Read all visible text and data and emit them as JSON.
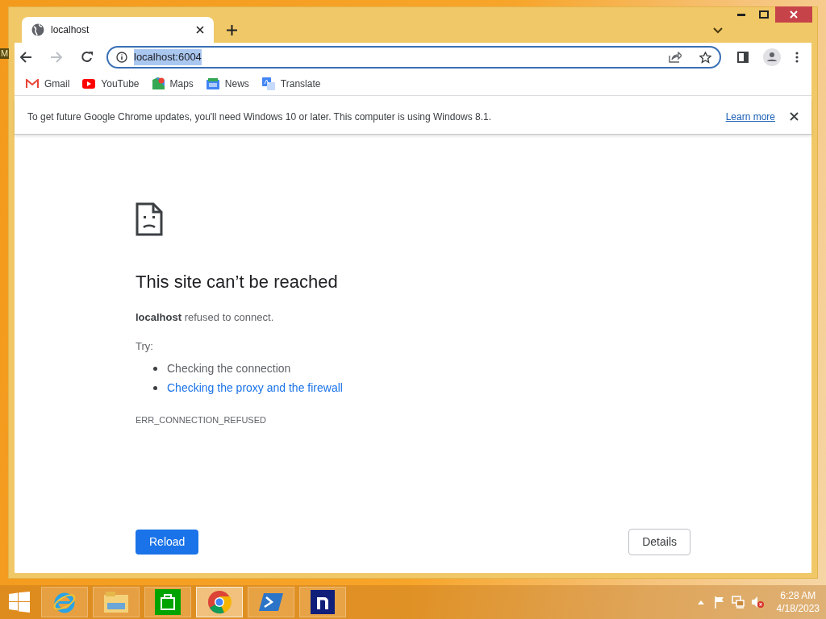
{
  "desktop_label": "M",
  "tab": {
    "title": "localhost",
    "selected": true
  },
  "address": {
    "value": "localhost:6004",
    "selected": true
  },
  "bookmarks": [
    {
      "kind": "gmail",
      "label": "Gmail"
    },
    {
      "kind": "youtube",
      "label": "YouTube"
    },
    {
      "kind": "maps",
      "label": "Maps"
    },
    {
      "kind": "news",
      "label": "News"
    },
    {
      "kind": "translate",
      "label": "Translate"
    }
  ],
  "infobar": {
    "message": "To get future Google Chrome updates, you'll need Windows 10 or later. This computer is using Windows 8.1.",
    "link": "Learn more"
  },
  "error": {
    "title": "This site can’t be reached",
    "message": "**localhost** refused to connect.",
    "try_label": "Try:",
    "suggestions": [
      {
        "text": "Checking the connection",
        "link": false
      },
      {
        "text": "Checking the proxy and the firewall",
        "link": true
      }
    ],
    "code": "ERR_CONNECTION_REFUSED",
    "reload": "Reload",
    "details": "Details"
  },
  "taskbar": {
    "apps": [
      {
        "kind": "ie",
        "selected": false
      },
      {
        "kind": "explorer",
        "selected": false
      },
      {
        "kind": "store",
        "selected": false
      },
      {
        "kind": "chrome",
        "selected": true
      },
      {
        "kind": "powershell",
        "selected": false
      },
      {
        "kind": "n",
        "selected": false
      }
    ],
    "time": "6:28 AM",
    "date": "4/18/2023"
  }
}
